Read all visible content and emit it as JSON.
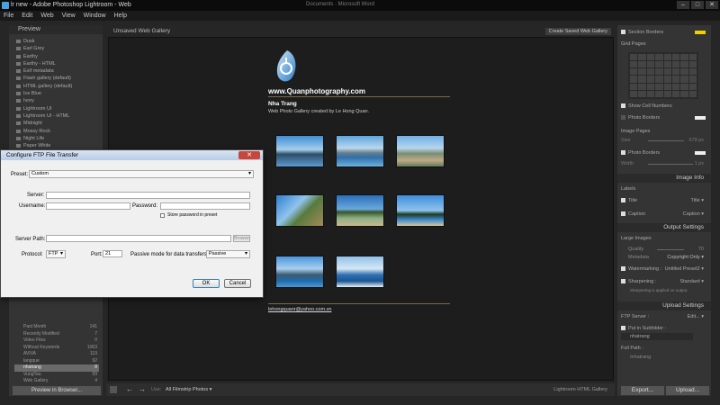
{
  "window": {
    "title": "lr new - Adobe Photoshop Lightroom - Web",
    "center_text": "Documents  ·  Microsoft Word",
    "controls": [
      "–",
      "□",
      "✕"
    ]
  },
  "menu": [
    "File",
    "Edit",
    "Web",
    "View",
    "Window",
    "Help"
  ],
  "left_panel": {
    "header": "Preview",
    "templates": [
      "Dusk",
      "Earl Grey",
      "Earthy",
      "Earthy - HTML",
      "Exif metadata",
      "Flash gallery (default)",
      "HTML gallery (default)",
      "Ice Blue",
      "Ivory",
      "Lightroom UI",
      "Lightroom UI - HTML",
      "Midnight",
      "Mossy Rock",
      "Night Life",
      "Paper White"
    ],
    "collections": [
      {
        "name": "Past Month",
        "count": "141"
      },
      {
        "name": "Recently Modified",
        "count": "7"
      },
      {
        "name": "Video Files",
        "count": "0"
      },
      {
        "name": "Without Keywords",
        "count": "1063"
      },
      {
        "name": "AVIVA",
        "count": "119"
      },
      {
        "name": "langque",
        "count": "92"
      },
      {
        "name": "nhatrang",
        "count": "8"
      },
      {
        "name": "VungTau",
        "count": "59"
      },
      {
        "name": "Web Gallery",
        "count": "4"
      }
    ],
    "selected_collection": "nhatrang",
    "preview_button": "Preview in Browser..."
  },
  "center": {
    "header": "Unsaved Web Gallery",
    "saved_button": "Create Saved Web Gallery",
    "site_url": "www.Quanphotography.com",
    "gallery_title": "Nha Trang",
    "gallery_desc": "Web Photo Gallery created by Le Hong Quan.",
    "email": "lehongquanr@yahoo.com.vn"
  },
  "toolbar": {
    "use": "Use:",
    "filmstrip": "All Filmstrip Photos ▾",
    "engine": "Lightroom HTML Gallery"
  },
  "right_panel": {
    "section_borders": "Section Borders",
    "grid_pages": "Grid Pages",
    "show_cell_numbers": "Show Cell Numbers",
    "photo_borders": "Photo Borders",
    "image_pages": "Image Pages",
    "size_label": "Size",
    "size_value": "678 px",
    "photo_borders2": "Photo Borders",
    "width_label": "Width",
    "width_value": "1 px",
    "image_info": "Image Info",
    "labels": "Labels",
    "title_label": "Title",
    "title_value": "Title ▾",
    "caption_label": "Caption",
    "caption_value": "Caption ▾",
    "output_settings": "Output Settings",
    "large_images": "Large Images",
    "quality_label": "Quality",
    "quality_value": "70",
    "metadata_label": "Metadata",
    "metadata_value": "Copyright Only ▾",
    "watermarking_label": "Watermarking :",
    "watermarking_value": "Untitled Preset2 ▾",
    "sharpening_label": "Sharpening :",
    "sharpening_value": "Standard ▾",
    "sharpening_note": "Sharpening is applied on output.",
    "upload_settings": "Upload Settings",
    "ftp_server_label": "FTP Server :",
    "ftp_server_value": "Edit... ▾",
    "put_in_subfolder": "Put in Subfolder :",
    "subfolder_value": "nhatrang",
    "full_path_label": "Full Path :",
    "full_path_value": "/nhatrang",
    "export_button": "Export...",
    "upload_button": "Upload..."
  },
  "dialog": {
    "title": "Configure FTP File Transfer",
    "preset_label": "Preset:",
    "preset_value": "Custom",
    "server_label": "Server:",
    "username_label": "Username:",
    "password_label": "Password:",
    "store_password": "Store password in preset",
    "server_path_label": "Server Path:",
    "browse": "Browse",
    "protocol_label": "Protocol:",
    "protocol_value": "FTP",
    "port_label": "Port:",
    "port_value": "21",
    "passive_label": "Passive mode for data transfers:",
    "passive_value": "Passive",
    "ok": "OK",
    "cancel": "Cancel"
  },
  "colors": {
    "accent": "#f0d000",
    "ui_bg": "#343434",
    "canvas_bg": "#1d1d1d",
    "title_gradient": "#b9cde6"
  }
}
